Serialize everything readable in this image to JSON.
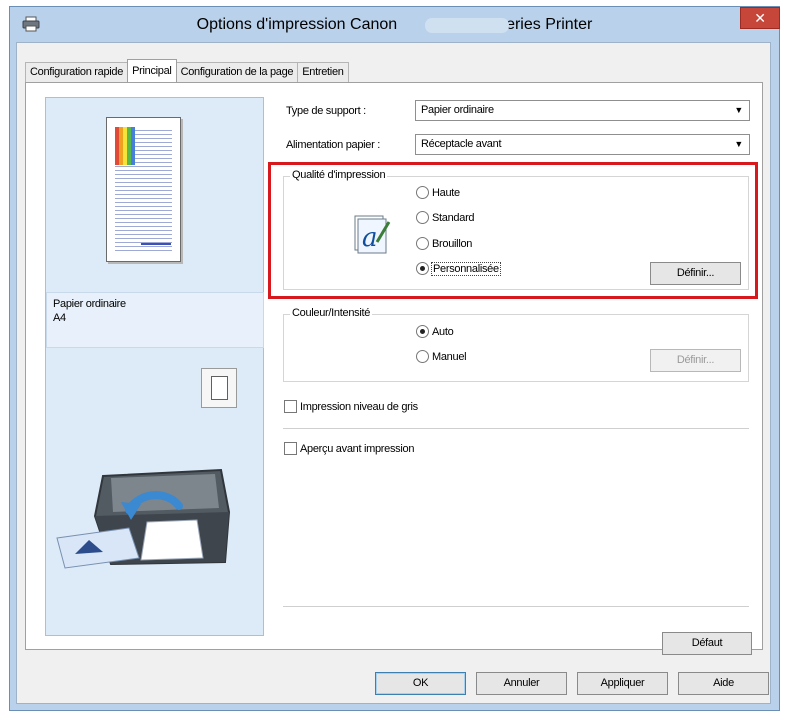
{
  "window": {
    "title": "Options d'impression Canon",
    "title_suffix": "series Printer",
    "close_label": "✕"
  },
  "tabs": [
    {
      "label": "Configuration rapide"
    },
    {
      "label": "Principal"
    },
    {
      "label": "Configuration de la page"
    },
    {
      "label": "Entretien"
    }
  ],
  "active_tab": "Principal",
  "preview": {
    "media_name": "Papier ordinaire",
    "paper_size": "A4"
  },
  "media_type": {
    "label": "Type de support :",
    "value": "Papier ordinaire"
  },
  "paper_source": {
    "label": "Alimentation papier :",
    "value": "Réceptacle avant"
  },
  "print_quality": {
    "title": "Qualité d'impression",
    "options": [
      "Haute",
      "Standard",
      "Brouillon",
      "Personnalisée"
    ],
    "selected": "Personnalisée",
    "set_button": "Définir..."
  },
  "color_intensity": {
    "title": "Couleur/Intensité",
    "options": [
      "Auto",
      "Manuel"
    ],
    "selected": "Auto",
    "set_button": "Définir..."
  },
  "grayscale": {
    "label": "Impression niveau de gris",
    "checked": false
  },
  "preview_before_print": {
    "label": "Aperçu avant impression",
    "checked": false
  },
  "defaults_button": "Défaut",
  "footer": {
    "ok": "OK",
    "cancel": "Annuler",
    "apply": "Appliquer",
    "help": "Aide"
  },
  "colors": {
    "titlebar": "#b9d1ea",
    "close": "#c7463a",
    "highlight": "#d7191d",
    "preview_panel": "#ddeaf8"
  }
}
